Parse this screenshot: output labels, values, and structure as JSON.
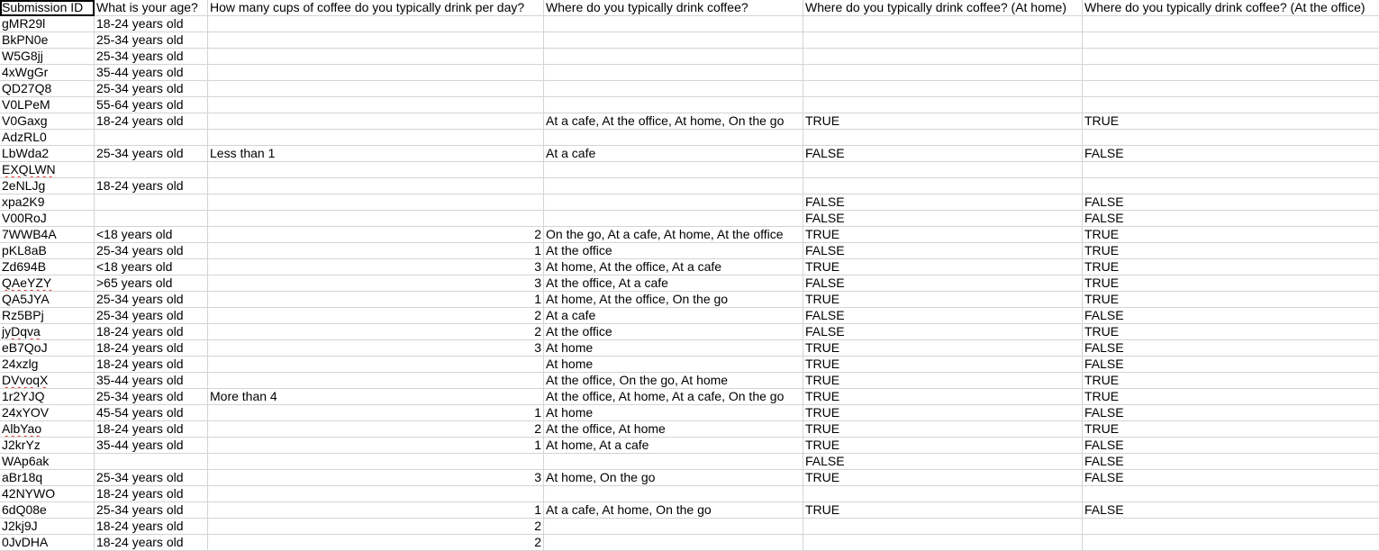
{
  "headers": [
    "Submission ID",
    "What is your age?",
    "How many cups of coffee do you typically drink per day?",
    "Where do you typically drink coffee?",
    "Where do you typically drink coffee? (At home)",
    "Where do you typically drink coffee? (At the office)"
  ],
  "rows": [
    [
      "gMR29l",
      "18-24 years old",
      "",
      "",
      "",
      ""
    ],
    [
      "BkPN0e",
      "25-34 years old",
      "",
      "",
      "",
      ""
    ],
    [
      "W5G8jj",
      "25-34 years old",
      "",
      "",
      "",
      ""
    ],
    [
      "4xWgGr",
      "35-44 years old",
      "",
      "",
      "",
      ""
    ],
    [
      "QD27Q8",
      "25-34 years old",
      "",
      "",
      "",
      ""
    ],
    [
      "V0LPeM",
      "55-64 years old",
      "",
      "",
      "",
      ""
    ],
    [
      "V0Gaxg",
      "18-24 years old",
      "",
      "At a cafe, At the office, At home, On the go",
      "TRUE",
      "TRUE"
    ],
    [
      "AdzRL0",
      "",
      "",
      "",
      "",
      ""
    ],
    [
      "LbWda2",
      "25-34 years old",
      "Less than 1",
      "At a cafe",
      "FALSE",
      "FALSE"
    ],
    [
      "EXQLWN",
      "",
      "",
      "",
      "",
      ""
    ],
    [
      "2eNLJg",
      "18-24 years old",
      "",
      "",
      "",
      ""
    ],
    [
      "xpa2K9",
      "",
      "",
      "",
      "FALSE",
      "FALSE"
    ],
    [
      "V00RoJ",
      "",
      "",
      "",
      "FALSE",
      "FALSE"
    ],
    [
      "7WWB4A",
      "<18 years old",
      "2",
      "On the go, At a cafe, At home, At the office",
      "TRUE",
      "TRUE"
    ],
    [
      "pKL8aB",
      "25-34 years old",
      "1",
      "At the office",
      "FALSE",
      "TRUE"
    ],
    [
      "Zd694B",
      "<18 years old",
      "3",
      "At home, At the office, At a cafe",
      "TRUE",
      "TRUE"
    ],
    [
      "QAeYZY",
      ">65 years old",
      "3",
      "At the office, At a cafe",
      "FALSE",
      "TRUE"
    ],
    [
      "QA5JYA",
      "25-34 years old",
      "1",
      "At home, At the office, On the go",
      "TRUE",
      "TRUE"
    ],
    [
      "Rz5BPj",
      "25-34 years old",
      "2",
      "At a cafe",
      "FALSE",
      "FALSE"
    ],
    [
      "jyDqva",
      "18-24 years old",
      "2",
      "At the office",
      "FALSE",
      "TRUE"
    ],
    [
      "eB7QoJ",
      "18-24 years old",
      "3",
      "At home",
      "TRUE",
      "FALSE"
    ],
    [
      "24xzlg",
      "18-24 years old",
      "",
      "At home",
      "TRUE",
      "FALSE"
    ],
    [
      "DVvoqX",
      "35-44 years old",
      "",
      "At the office, On the go, At home",
      "TRUE",
      "TRUE"
    ],
    [
      "1r2YJQ",
      "25-34 years old",
      "More than 4",
      "At the office, At home, At a cafe, On the go",
      "TRUE",
      "TRUE"
    ],
    [
      "24xYOV",
      "45-54 years old",
      "1",
      "At home",
      "TRUE",
      "FALSE"
    ],
    [
      "AlbYao",
      "18-24 years old",
      "2",
      "At the office, At home",
      "TRUE",
      "TRUE"
    ],
    [
      "J2krYz",
      "35-44 years old",
      "1",
      "At home, At a cafe",
      "TRUE",
      "FALSE"
    ],
    [
      "WAp6ak",
      "",
      "",
      "",
      "FALSE",
      "FALSE"
    ],
    [
      "aBr18q",
      "25-34 years old",
      "3",
      "At home, On the go",
      "TRUE",
      "FALSE"
    ],
    [
      "42NYWO",
      "18-24 years old",
      "",
      "",
      "",
      ""
    ],
    [
      "6dQ08e",
      "25-34 years old",
      "1",
      "At a cafe, At home, On the go",
      "TRUE",
      "FALSE"
    ],
    [
      "J2kj9J",
      "18-24 years old",
      "2",
      "",
      "",
      ""
    ],
    [
      "0JvDHA",
      "18-24 years old",
      "2",
      "",
      "",
      ""
    ]
  ],
  "spellcheck_flagged_ids": [
    "EXQLWN",
    "QAeYZY",
    "jyDqva",
    "DVvoqX",
    "AlbYao"
  ]
}
